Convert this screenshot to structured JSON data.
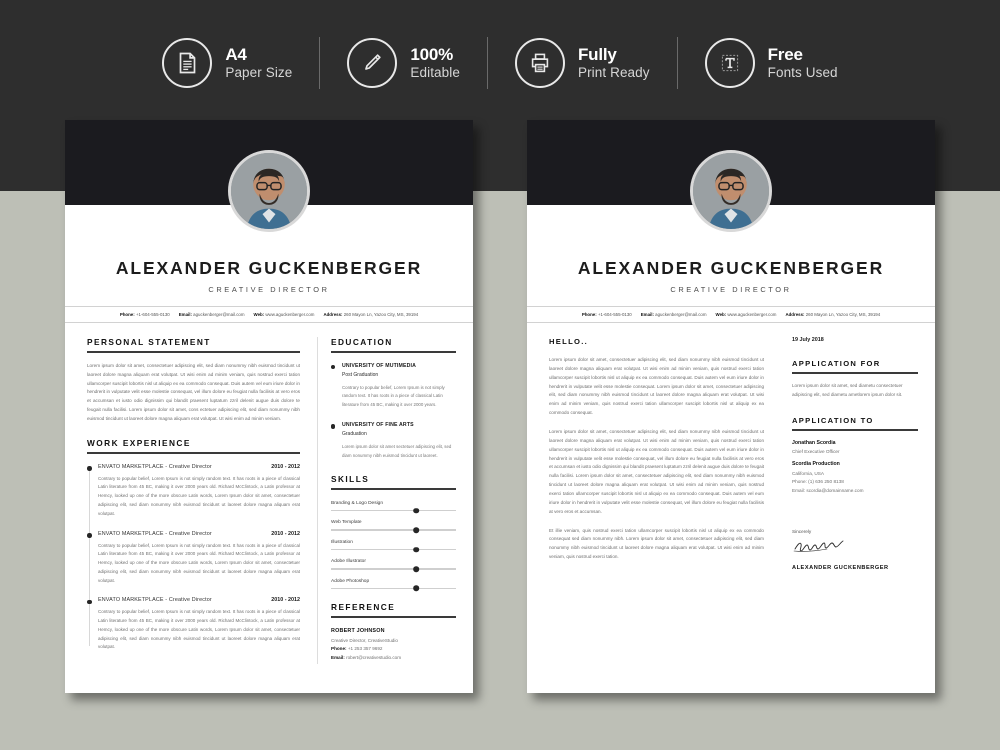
{
  "banner": {
    "badges": [
      {
        "icon": "document-icon",
        "title": "A4",
        "subtitle": "Paper Size"
      },
      {
        "icon": "pencil-icon",
        "title": "100%",
        "subtitle": "Editable"
      },
      {
        "icon": "printer-icon",
        "title": "Fully",
        "subtitle": "Print Ready"
      },
      {
        "icon": "typography-icon",
        "title": "Free",
        "subtitle": "Fonts Used"
      }
    ]
  },
  "colors": {
    "banner_bg": "#2e2e2e",
    "page_band": "#1b1b1f",
    "canvas_bg": "#bdbfb6",
    "accent": "#3a3a3a"
  },
  "resume": {
    "name": "ALEXANDER GUCKENBERGER",
    "role": "CREATIVE DIRECTOR",
    "contact": {
      "phone_label": "Phone:",
      "phone": "+1-604-555-0130",
      "email_label": "Email:",
      "email": "aguckenberger@mail.com",
      "web_label": "Web:",
      "web": "www.aguckenberger.com",
      "address_label": "Address:",
      "address": "260 Mayon Ln, Yazoo City, MS, 39194"
    },
    "personal_statement": {
      "heading": "PERSONAL STATEMENT",
      "body": "Lorem ipsum dolor sit amet, consectetuer adipiscing elit, sed diam nonummy nibh euismod tincidunt ut laoreet dolore magna aliquam erat volutpat. Ut wisi enim ad minim veniam, quis nostrud exerci tation ullamcorper suscipit lobortis nisl ut aliquip ex ea commodo consequat. Duis autem vel eum iriure dolor in hendrerit in vulputate velit esse molestie consequat, vel illum dolore eu feugiat nulla facilisis at vero eros et accumsan et iusto odio dignissim qui blandit praesent luptatum zzril delenit augue duis dolore te feugait nulla facilisi. Lorem ipsum dolor sit amet, cons ectetuer adipiscing elit, sed diam nonummy nibh euismod tincidunt ut laoreet dolore magna aliquam erat volutpat. Ut wisi enim ad minim veniam."
    },
    "work_experience": {
      "heading": "WORK EXPERIENCE",
      "jobs": [
        {
          "company": "ENVATO MARKETPLACE",
          "title": " - Creative Director",
          "dates": "2010 - 2012",
          "desc": "Contrary to popular belief, Lorem Ipsum is not simply random text. It has roots in a piece of classical Latin literature from 45 BC, making it over 2000 years old. Richard McClintock, a Latin professor at Hemcy, looked up one of the more obscure Latin words, Lorem Ipsum dolor sit amet, consectetuer adipiscing elit, sed diam nonummy nibh euismod tincidunt ut laoreet dolore magna aliquam erat volutpat."
        },
        {
          "company": "ENVATO MARKETPLACE",
          "title": " - Creative Director",
          "dates": "2010 - 2012",
          "desc": "Contrary to popular belief, Lorem Ipsum is not simply random text. It has roots in a piece of classical Latin literature from 45 BC, making it over 2000 years old. Richard McClintock, a Latin professor at Hemcy, looked up one of the more obscure Latin words, Lorem Ipsum dolor sit amet, consectetuer adipiscing elit, sed diam nonummy nibh euismod tincidunt ut laoreet dolore magna aliquam erat volutpat."
        },
        {
          "company": "ENVATO MARKETPLACE",
          "title": " - Creative Director",
          "dates": "2010 - 2012",
          "desc": "Contrary to popular belief, Lorem Ipsum is not simply random text. It has roots in a piece of classical Latin literature from 45 BC, making it over 2000 years old. Richard McClintock, a Latin professor at Hemcy, looked up one of the more obscure Latin words, Lorem Ipsum dolor sit amet, consectetuer adipiscing elit, sed diam nonummy nibh euismod tincidunt ut laoreet dolore magna aliquam erat volutpat."
        }
      ]
    },
    "education": {
      "heading": "EDUCATION",
      "items": [
        {
          "school": "UNIVERSITY OF MUTIMEDIA",
          "degree": "Post Graduation",
          "desc": "Contrary to popular belief, Lorem Ipsum is not simply random text. It has roots in a piece of classical Latin literature from 45 BC, making it over 2000 years."
        },
        {
          "school": "UNIVERSITY OF FINE ARTS",
          "degree": "Graduation",
          "desc": "Lorem ipsum dolor sit amet sectetuer adipiscing elit, sed diam nonummy nibh euismod tincidunt ut laoreet."
        }
      ]
    },
    "skills": {
      "heading": "SKILLS",
      "items": [
        {
          "name": "Branding & Logo Design",
          "level": 68
        },
        {
          "name": "Web Template",
          "level": 68
        },
        {
          "name": "Illustration",
          "level": 68
        },
        {
          "name": "Adobe Illustrator",
          "level": 68
        },
        {
          "name": "Adobe Photoshop",
          "level": 68
        }
      ]
    },
    "reference": {
      "heading": "REFERENCE",
      "name": "ROBERT JOHNSON",
      "role": "Creative Director, CreativeStudio",
      "phone_label": "Phone:",
      "phone": "+1 253 357 9692",
      "email_label": "Email:",
      "email": "robert@creativestudio.com"
    }
  },
  "cover_letter": {
    "greeting": "HELLO..",
    "date": "19 July 2018",
    "paragraphs": [
      "Lorem ipsum dolor sit amet, consectetuer adipiscing elit, sed diam nonummy nibh euismod tincidunt ut laoreet dolore magna aliquam erat volutpat. Ut wisi enim ad minim veniam, quis nostrud exerci tation ullamcorper suscipit lobortis nisl ut aliquip ex ea commodo consequat. Duis autem vel eum iriure dolor in hendrerit in vulputate velit esse molestie consequat. Lorem ipsum dolor sit amet, consectetuer adipiscing elit, sed diam nonummy nibh euismod tincidunt ut laoreet dolore magna aliquam erat volutpat. Ut wisi enim ad minim veniam, quis nostrud exerci tation ullamcorper suscipit lobortis nisl ut aliquip ex ea commodo consequat.",
      "Lorem ipsum dolor sit amet, consectetuer adipiscing elit, sed diam nonummy nibh euismod tincidunt ut laoreet dolore magna aliquam erat volutpat. Ut wisi enim ad minim veniam, quis nostrud exerci tation ullamcorper suscipit lobortis nisl ut aliquip ex ea commodo consequat. Duis autem vel eum iriure dolor in hendrerit in vulputate velit esse molestie consequat, vel illum dolore eu feugiat nulla facilisis at vero eros et accumsan et iusto odio dignissim qui blandit praesent luptatum zzril delenit augue duis dolore te feugait nulla facilisi. Lorem ipsum dolor sit amet, consectetuer adipiscing elit, sed diam nonummy nibh euismod tincidunt ut laoreet dolore magna aliquam erat volutpat. Ut wisi enim ad minim veniam, quis nostrud exerci tation ullamcorper suscipit lobortis nisl ut aliquip ex ea commodo consequat. Duis autem vel eum iriure dolor in hendrerit in vulputate velit esse molestie consequat, vel illum dolore eu feugiat nulla facilisis at vero eros et accumsan.",
      "Et illie veniam, quis nostrud exerci tation ullamcorper suscipit lobortis nisl ut aliquip ex ea commodo consequat sed diam nonummy nibh. Lorem ipsum dolor sit amet, consectetuer adipiscing elit, sed diam nonummy nibh euismod tincidunt ut laoreet dolore magna aliquam erat volutpat. Ut wisi enim ad minim veniam, quis nostrud exerci tation."
    ],
    "application_for": {
      "heading": "APPLICATION FOR",
      "body": "Lorem ipsum dolor sit amet, sed diametu consectetuer adipiscing elit, sed diametu ametlorem ipsum dolor sit."
    },
    "application_to": {
      "heading": "APPLICATION TO",
      "person": "Jonathan Scordia",
      "person_role": "Chief Executive Officer",
      "company": "Scordia Production",
      "location": "California, USA",
      "phone_label": "Phone:",
      "phone": "(1) 636 250 8138",
      "email_label": "Email:",
      "email": "scordia@domainname.com"
    },
    "signature": {
      "sincerely": "Sincerely",
      "name": "ALEXANDER GUCKENBERGER"
    }
  }
}
